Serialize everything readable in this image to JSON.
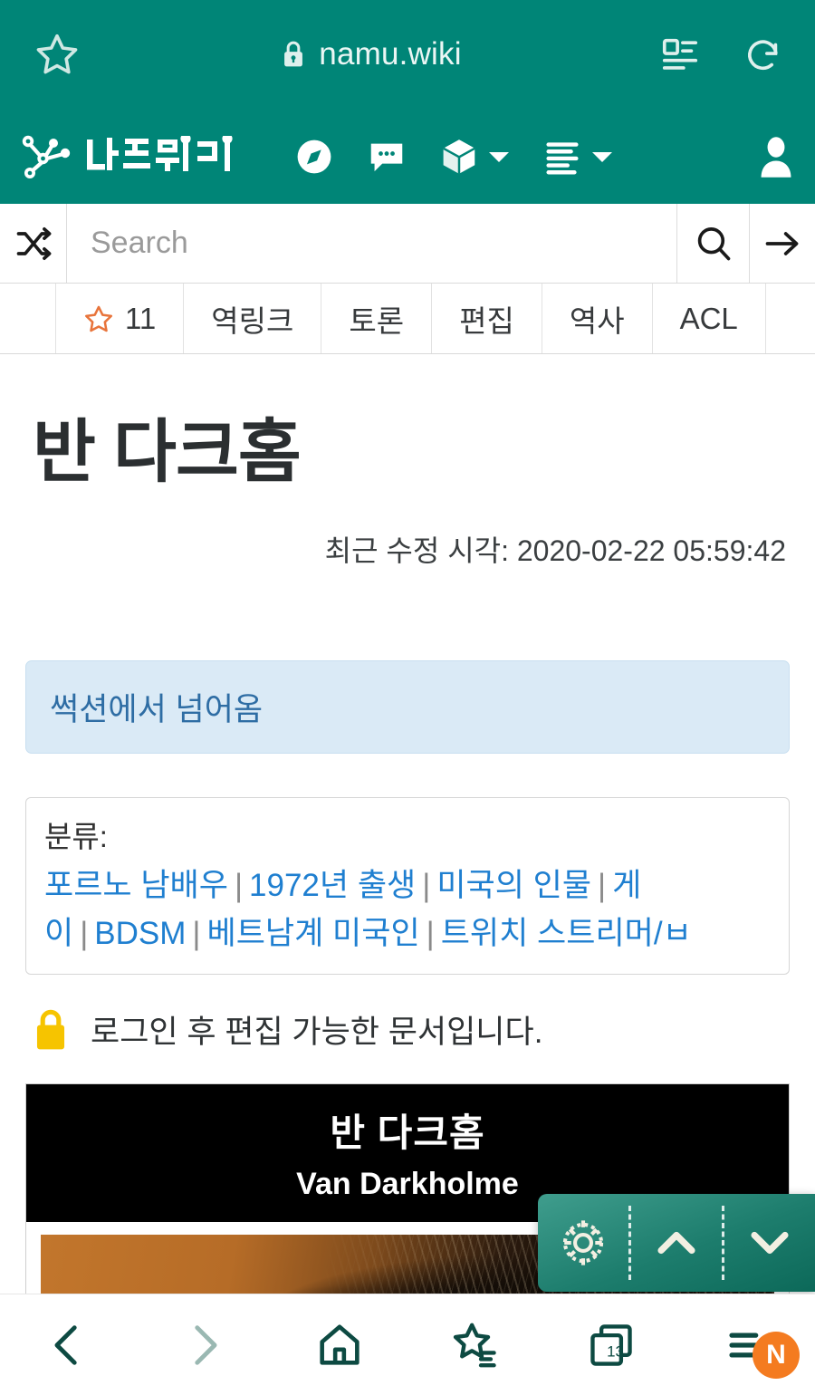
{
  "browser": {
    "url": "namu.wiki",
    "icons": {
      "bookmark_star": "star-outline-icon",
      "lock": "lock-icon",
      "reader": "reader-view-icon",
      "reload": "reload-icon"
    }
  },
  "navbar": {
    "logo_text": "나무위키",
    "icons": {
      "compass": "compass-icon",
      "chat": "chat-bubble-icon",
      "cube": "cube-icon",
      "list": "list-lines-icon",
      "user": "user-avatar-icon",
      "caret": "chevron-down-icon"
    }
  },
  "search": {
    "placeholder": "Search",
    "value": "",
    "shuffle_icon": "shuffle-icon",
    "search_icon": "magnifier-icon",
    "go_icon": "arrow-right-icon"
  },
  "tabs": [
    {
      "label": "11",
      "icon": "star-outline-icon",
      "name": "star-count"
    },
    {
      "label": "역링크",
      "name": "backlinks"
    },
    {
      "label": "토론",
      "name": "discussion"
    },
    {
      "label": "편집",
      "name": "edit"
    },
    {
      "label": "역사",
      "name": "history"
    },
    {
      "label": "ACL",
      "name": "acl"
    }
  ],
  "article": {
    "title": "반 다크홈",
    "revision_time": "최근 수정 시각: 2020-02-22 05:59:42",
    "redirect_notice": "썩션에서 넘어옴",
    "categories_label": "분류:",
    "categories": [
      "포르노 남배우",
      "1972년 출생",
      "미국의 인물",
      "게이",
      "BDSM",
      "베트남계 미국인",
      "트위치 스트리머/ㅂ"
    ],
    "category_separator": "|",
    "lock_notice": "로그인 후 편집 가능한 문서입니다.",
    "infobox": {
      "title_kr": "반 다크홈",
      "title_en": "Van Darkholme"
    }
  },
  "float_toolbar": {
    "gear": "gear-icon",
    "up": "chevron-up-icon",
    "down": "chevron-down-icon"
  },
  "bottom_nav": {
    "back": "chevron-left-icon",
    "forward": "chevron-right-icon",
    "home": "home-icon",
    "bookmarks": "bookmark-star-icon",
    "tabs_count": "13",
    "tabs": "tab-stack-icon",
    "menu": "hamburger-menu-icon",
    "badge": "N"
  },
  "colors": {
    "teal": "#008577",
    "orange": "#F47B20",
    "link_blue": "#1f7fd0",
    "redirect_bg": "#daeaf6",
    "lock_yellow": "#F6C400"
  }
}
